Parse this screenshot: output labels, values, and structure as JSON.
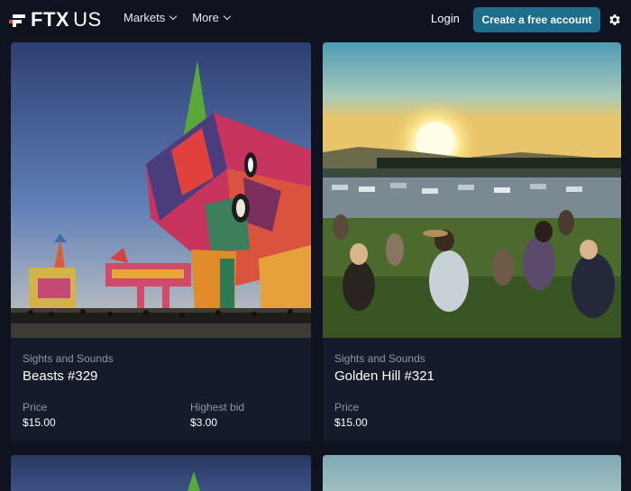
{
  "header": {
    "logo_text": "FTX",
    "logo_suffix": "US",
    "nav": [
      {
        "label": "Markets"
      },
      {
        "label": "More"
      }
    ],
    "login_label": "Login",
    "cta_label": "Create a free account"
  },
  "cards": [
    {
      "collection": "Sights and Sounds",
      "title": "Beasts #329",
      "price_label": "Price",
      "price": "$15.00",
      "bid_label": "Highest bid",
      "bid": "$3.00"
    },
    {
      "collection": "Sights and Sounds",
      "title": "Golden Hill #321",
      "price_label": "Price",
      "price": "$15.00"
    }
  ],
  "colors": {
    "background": "#0f1320",
    "card": "#151b2a",
    "accent_button": "#1f6e8e",
    "muted_text": "#8e97a8",
    "logo_red": "#e64a3b"
  },
  "icons": [
    "ftx-logo-icon",
    "chevron-down-icon",
    "gear-icon"
  ]
}
